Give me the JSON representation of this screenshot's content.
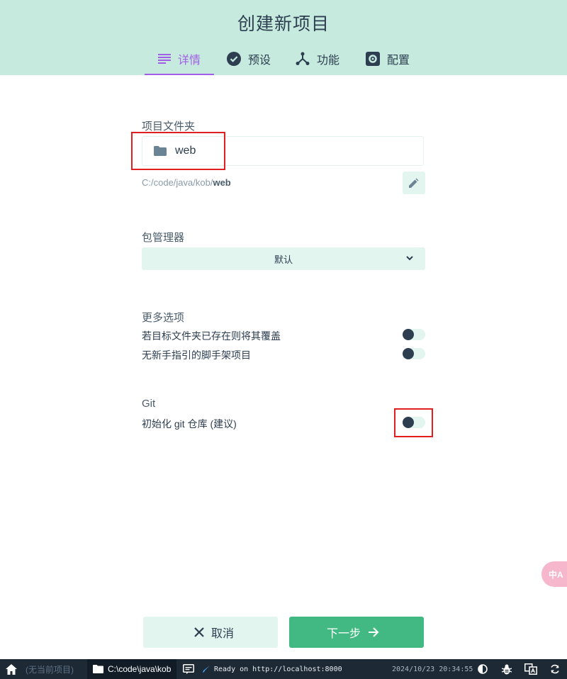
{
  "header": {
    "title": "创建新项目"
  },
  "tabs": [
    {
      "label": "详情",
      "icon": "details-icon",
      "active": true
    },
    {
      "label": "预设",
      "icon": "check-circle-icon",
      "active": false
    },
    {
      "label": "功能",
      "icon": "features-icon",
      "active": false
    },
    {
      "label": "配置",
      "icon": "settings-icon",
      "active": false
    }
  ],
  "folder": {
    "label": "项目文件夹",
    "value": "web",
    "path_prefix": "C:/code/java/kob/",
    "path_name": "web"
  },
  "package_manager": {
    "label": "包管理器",
    "selected": "默认"
  },
  "more_options": {
    "label": "更多选项",
    "options": [
      {
        "label": "若目标文件夹已存在则将其覆盖",
        "enabled": false
      },
      {
        "label": "无新手指引的脚手架项目",
        "enabled": false
      }
    ]
  },
  "git": {
    "label": "Git",
    "option": {
      "label": "初始化 git 仓库 (建议)",
      "enabled": false
    }
  },
  "footer": {
    "cancel_label": "取消",
    "next_label": "下一步"
  },
  "translate_widget": {
    "label": "中A"
  },
  "statusbar": {
    "no_project": "(无当前项目)",
    "cwd": "C:\\code\\java\\kob",
    "log": "Ready on http://localhost:8000",
    "datetime": "2024/10/23 20:34:55"
  },
  "colors": {
    "header_bg": "#c6eade",
    "accent_purple": "#a25ee8",
    "accent_green": "#42b983",
    "light_green": "#e2f5ee",
    "dark": "#2c3e50",
    "statusbar_bg": "#1d2935",
    "highlight_red": "#e02020"
  }
}
